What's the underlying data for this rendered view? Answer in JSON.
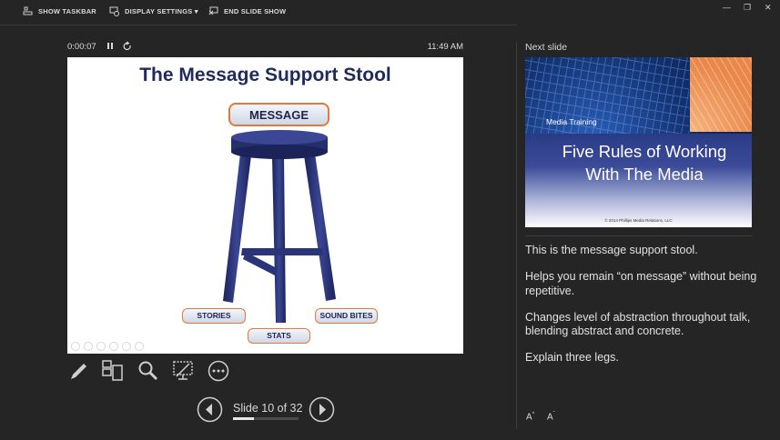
{
  "toolbar": {
    "show_taskbar": "SHOW TASKBAR",
    "display_settings": "DISPLAY SETTINGS ▾",
    "end_slide_show": "END SLIDE SHOW"
  },
  "presenter": {
    "timer": "0:00:07",
    "clock": "11:49 AM"
  },
  "current_slide": {
    "title": "The Message Support Stool",
    "main_label": "MESSAGE",
    "legs": [
      "STORIES",
      "SOUND BITES",
      "STATS"
    ]
  },
  "navigation": {
    "slide_counter": "Slide 10 of 32",
    "progress": 0.3125
  },
  "next_slide": {
    "label": "Next slide",
    "header": "Media Training",
    "title_line1": "Five Rules of Working",
    "title_line2": "With The Media",
    "copyright": "© 2014 Phillips Media Relations, LLC"
  },
  "notes": [
    "This is the message support stool.",
    "Helps you remain “on message” without being repetitive.",
    "Changes level of abstraction throughout talk, blending abstract and concrete.",
    "Explain three legs."
  ],
  "colors": {
    "background": "#252525",
    "slide_title": "#1f2a5e",
    "stool": "#252f6b",
    "accent_border": "#e07a3a"
  },
  "icons": [
    "taskbar-icon",
    "display-settings-icon",
    "end-show-icon",
    "minimize-icon",
    "restore-icon",
    "pause-icon",
    "restart-icon",
    "pen-icon",
    "see-all-slides-icon",
    "zoom-icon",
    "black-screen-icon",
    "more-options-icon",
    "previous-icon",
    "next-icon",
    "increase-font-icon",
    "decrease-font-icon"
  ]
}
